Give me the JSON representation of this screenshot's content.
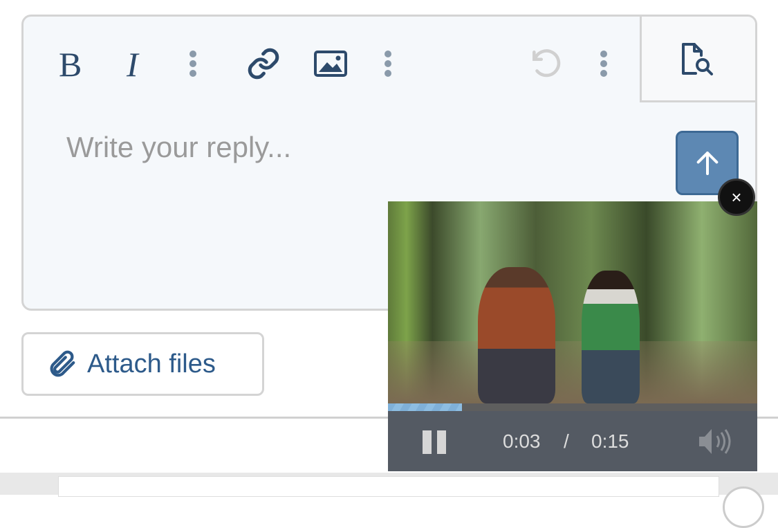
{
  "editor": {
    "toolbar": {
      "bold": "bold-icon",
      "italic": "italic-icon",
      "more1": "more-vertical-icon",
      "link": "link-icon",
      "image": "image-icon",
      "more2": "more-vertical-icon",
      "undo": "undo-icon",
      "more3": "more-vertical-icon",
      "preview": "document-search-icon"
    },
    "placeholder": "Write your reply...",
    "send_icon": "arrow-up-icon"
  },
  "attach": {
    "label": "Attach files",
    "icon": "paperclip-icon"
  },
  "video": {
    "close_label": "×",
    "progress": 0.2,
    "current_time": "0:03",
    "separator": "/",
    "duration": "0:15",
    "state": "playing"
  },
  "colors": {
    "accent": "#5d88b3",
    "icon": "#2d4a6b",
    "progress": "#7fb0d8",
    "controls_bg": "#545a63"
  }
}
